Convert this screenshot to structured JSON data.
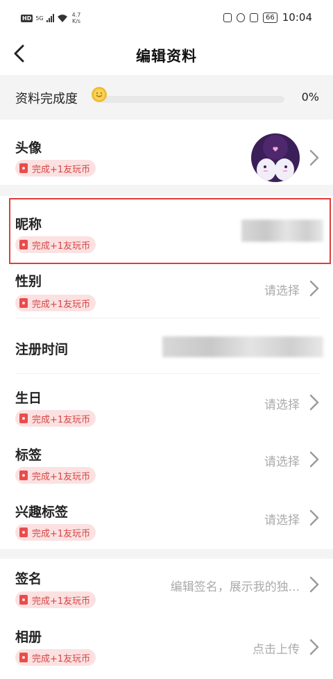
{
  "status_bar": {
    "hd": "HD",
    "signal": "5G",
    "speed_value": "4.7",
    "speed_unit": "K/s",
    "battery": "66",
    "time": "10:04"
  },
  "nav": {
    "title": "编辑资料"
  },
  "completeness": {
    "label": "资料完成度",
    "value": "0%",
    "progress": 0
  },
  "reward_text": "完成+1友玩币",
  "rows": {
    "avatar": {
      "label": "头像"
    },
    "nickname": {
      "label": "昵称"
    },
    "gender": {
      "label": "性别",
      "value": "请选择"
    },
    "register_time": {
      "label": "注册时间"
    },
    "birthday": {
      "label": "生日",
      "value": "请选择"
    },
    "tags": {
      "label": "标签",
      "value": "请选择"
    },
    "interest_tags": {
      "label": "兴趣标签",
      "value": "请选择"
    },
    "signature": {
      "label": "签名",
      "value": "编辑签名，展示我的独..."
    },
    "album": {
      "label": "相册",
      "value": "点击上传"
    }
  },
  "colors": {
    "accent": "#e23b3b",
    "badge_bg": "#fbe1e1",
    "badge_text": "#d64545",
    "coin": "#f3bc2c"
  },
  "icons": [
    "back-arrow-icon",
    "coin-icon",
    "reward-icon",
    "chevron-right-icon",
    "avatar-image"
  ]
}
